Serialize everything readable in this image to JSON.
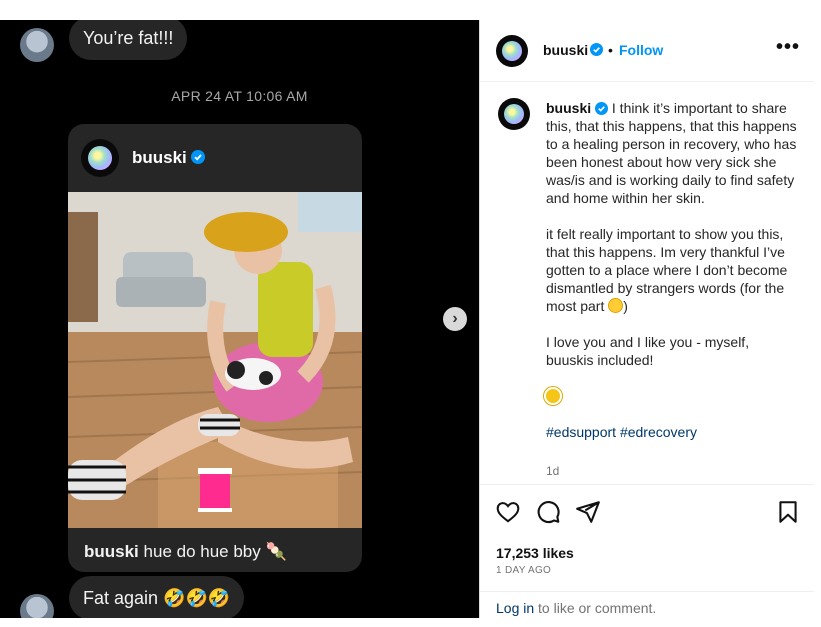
{
  "dm": {
    "message_1": "You’re fat!!!",
    "timestamp": "APR 24 AT 10:06 AM",
    "shared_post": {
      "username": "buuski",
      "caption_user": "buuski",
      "caption_text": "hue do hue bby 🍡"
    },
    "message_2": "Fat again 🤣🤣🤣"
  },
  "post": {
    "username": "buuski",
    "separator": "•",
    "follow_label": "Follow",
    "more_label": "•••",
    "caption_user": "buuski",
    "caption_p1": "I think it’s important to share this, that this happens, that this happens to a healing person in recovery, who has been honest about how very sick she was/is and is working daily to find safety and home within her skin.",
    "caption_p2": "it felt really important to show you this, that this happens. Im very thankful I’ve gotten to a place where I don’t become dismantled by strangers words (for the most part",
    "caption_p2_end": ")",
    "caption_p3": "I love you and I like you - myself, buuskis included!",
    "hashtags": "#edsupport #edrecovery",
    "time_ago": "1d",
    "likes": "17,253 likes",
    "date": "1 DAY AGO",
    "login_link": "Log in",
    "login_text": " to like or comment."
  },
  "icons": {
    "verified_color": "#0095f6",
    "follow_color": "#0095f6"
  }
}
